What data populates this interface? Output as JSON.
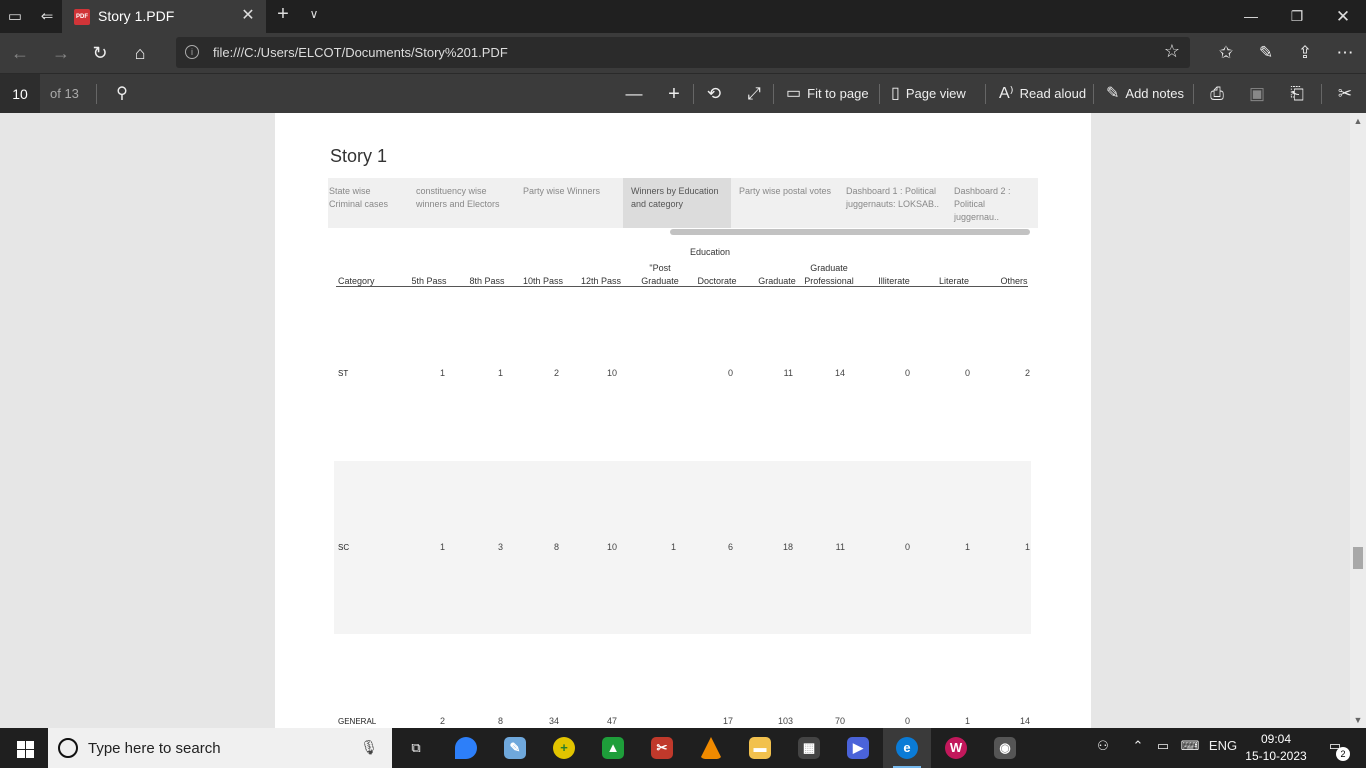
{
  "tab": {
    "title": "Story 1.PDF",
    "badge": "PDF"
  },
  "address": {
    "url": "file:///C:/Users/ELCOT/Documents/Story%201.PDF"
  },
  "pdf_toolbar": {
    "page_current": "10",
    "page_total": "of 13",
    "fit_to_page": "Fit to page",
    "page_view": "Page view",
    "read_aloud": "Read aloud",
    "add_notes": "Add notes"
  },
  "document": {
    "title": "Story 1",
    "story_tabs": [
      {
        "label": "State wise Criminal cases"
      },
      {
        "label": "constituency wise winners and Electors"
      },
      {
        "label": "Party wise Winners"
      },
      {
        "label": "Winners by Education and category"
      },
      {
        "label": "Party wise postal votes"
      },
      {
        "label": "Dashboard 1 : Political juggernauts: LOKSAB.."
      },
      {
        "label": "Dashboard 2 : Political juggernau.."
      }
    ],
    "table": {
      "group_header": "Education",
      "category_header": "Category",
      "columns": [
        {
          "top": "",
          "bottom": "5th Pass"
        },
        {
          "top": "",
          "bottom": "8th Pass"
        },
        {
          "top": "",
          "bottom": "10th Pass"
        },
        {
          "top": "",
          "bottom": "12th Pass"
        },
        {
          "top": "\"Post",
          "bottom": "Graduate"
        },
        {
          "top": "",
          "bottom": "Doctorate"
        },
        {
          "top": "",
          "bottom": "Graduate"
        },
        {
          "top": "Graduate",
          "bottom": "Professional"
        },
        {
          "top": "",
          "bottom": "Illiterate"
        },
        {
          "top": "",
          "bottom": "Literate"
        },
        {
          "top": "",
          "bottom": "Others"
        }
      ],
      "rows": [
        {
          "category": "ST",
          "values": [
            "1",
            "1",
            "2",
            "10",
            "",
            "0",
            "11",
            "14",
            "0",
            "0",
            "2"
          ]
        },
        {
          "category": "SC",
          "values": [
            "1",
            "3",
            "8",
            "10",
            "1",
            "6",
            "18",
            "11",
            "0",
            "1",
            "1"
          ]
        },
        {
          "category": "GENERAL",
          "values": [
            "2",
            "8",
            "34",
            "47",
            "",
            "17",
            "103",
            "70",
            "0",
            "1",
            "14"
          ]
        }
      ]
    }
  },
  "taskbar": {
    "search_placeholder": "Type here to search",
    "language": "ENG",
    "time": "09:04",
    "date": "15-10-2023",
    "notifications": "2"
  }
}
